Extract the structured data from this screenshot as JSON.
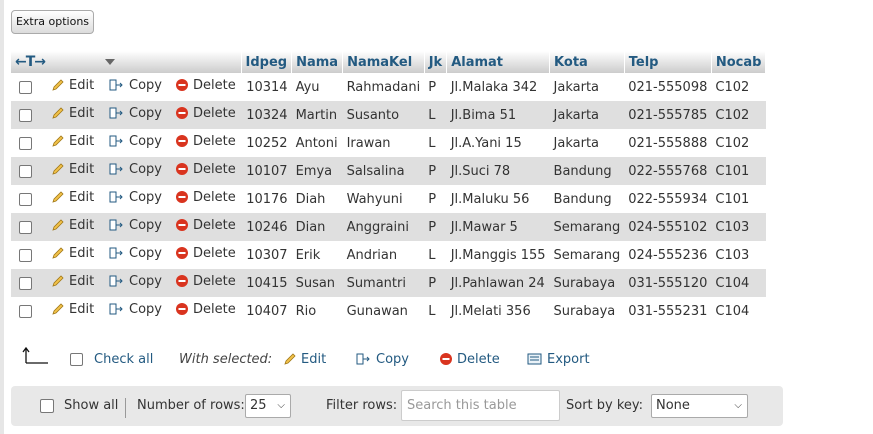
{
  "toolbar": {
    "extra_options": "Extra options"
  },
  "table": {
    "sort_arrows": "←T→",
    "columns": [
      "Idpeg",
      "Nama",
      "NamaKel",
      "Jk",
      "Alamat",
      "Kota",
      "Telp",
      "Nocab"
    ],
    "actions": {
      "edit": "Edit",
      "copy": "Copy",
      "delete": "Delete"
    },
    "rows": [
      [
        "10314",
        "Ayu",
        "Rahmadani",
        "P",
        "Jl.Malaka 342",
        "Jakarta",
        "021-555098",
        "C102"
      ],
      [
        "10324",
        "Martin",
        "Susanto",
        "L",
        "Jl.Bima 51",
        "Jakarta",
        "021-555785",
        "C102"
      ],
      [
        "10252",
        "Antoni",
        "Irawan",
        "L",
        "Jl.A.Yani 15",
        "Jakarta",
        "021-555888",
        "C102"
      ],
      [
        "10107",
        "Emya",
        "Salsalina",
        "P",
        "Jl.Suci 78",
        "Bandung",
        "022-555768",
        "C101"
      ],
      [
        "10176",
        "Diah",
        "Wahyuni",
        "P",
        "Jl.Maluku 56",
        "Bandung",
        "022-555934",
        "C101"
      ],
      [
        "10246",
        "Dian",
        "Anggraini",
        "P",
        "Jl.Mawar 5",
        "Semarang",
        "024-555102",
        "C103"
      ],
      [
        "10307",
        "Erik",
        "Andrian",
        "L",
        "Jl.Manggis 155",
        "Semarang",
        "024-555236",
        "C103"
      ],
      [
        "10415",
        "Susan",
        "Sumantri",
        "P",
        "Jl.Pahlawan 24",
        "Surabaya",
        "031-555120",
        "C104"
      ],
      [
        "10407",
        "Rio",
        "Gunawan",
        "L",
        "Jl.Melati 356",
        "Surabaya",
        "031-555231",
        "C104"
      ]
    ]
  },
  "bulk": {
    "check_all": "Check all",
    "with_selected": "With selected:",
    "edit": "Edit",
    "copy": "Copy",
    "delete": "Delete",
    "export": "Export"
  },
  "nav": {
    "show_all": "Show all",
    "number_of_rows_label": "Number of rows:",
    "number_of_rows_value": "25",
    "filter_rows_label": "Filter rows:",
    "filter_placeholder": "Search this table",
    "sort_by_key_label": "Sort by key:",
    "sort_by_key_value": "None"
  },
  "colors": {
    "link": "#235a81",
    "row_even": "#dfdfdf",
    "delete_red": "#d9341f"
  }
}
